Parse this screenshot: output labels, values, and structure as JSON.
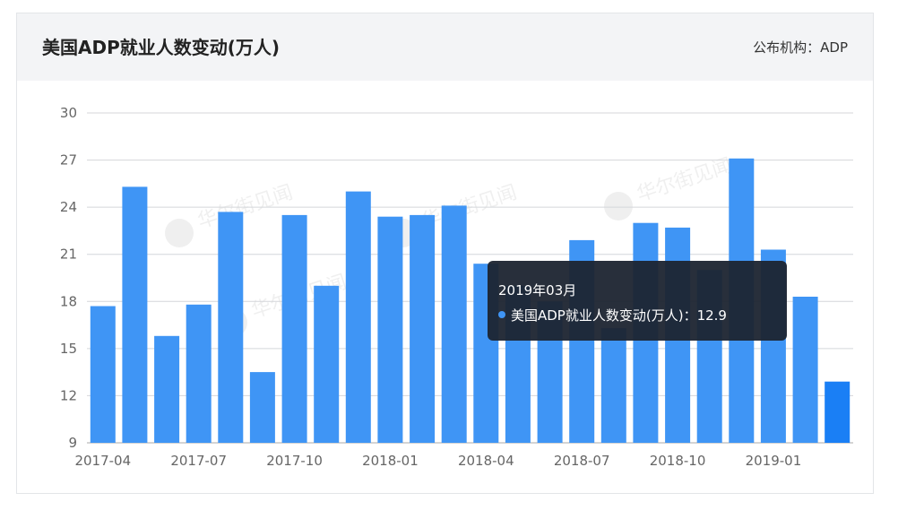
{
  "header": {
    "title": "美国ADP就业人数变动(万人)",
    "source_label": "公布机构：",
    "source_value": "ADP"
  },
  "colors": {
    "bar": "#3f95f5",
    "bar_highlight": "#1a7ff5",
    "grid": "#d4d6da",
    "axis": "#aaaaaa",
    "tooltip_bg": "#1c2430"
  },
  "watermark": {
    "text": "华尔街见闻",
    "icon": "wallstreetcn-logo-icon"
  },
  "chart_data": {
    "type": "bar",
    "title": "美国ADP就业人数变动(万人)",
    "categories": [
      "2017-04",
      "2017-05",
      "2017-06",
      "2017-07",
      "2017-08",
      "2017-09",
      "2017-10",
      "2017-11",
      "2017-12",
      "2018-01",
      "2018-02",
      "2018-03",
      "2018-04",
      "2018-05",
      "2018-06",
      "2018-07",
      "2018-08",
      "2018-09",
      "2018-10",
      "2018-11",
      "2018-12",
      "2019-01",
      "2019-02",
      "2019-03"
    ],
    "series": [
      {
        "name": "美国ADP就业人数变动(万人)",
        "values": [
          17.7,
          25.3,
          15.8,
          17.8,
          23.7,
          13.5,
          23.5,
          19.0,
          25.0,
          23.4,
          23.5,
          24.1,
          20.4,
          19.0,
          18.0,
          21.9,
          16.3,
          23.0,
          22.7,
          20.0,
          27.1,
          21.3,
          18.3,
          12.9
        ]
      }
    ],
    "xlabel": "",
    "ylabel": "",
    "ylim": [
      9,
      30
    ],
    "yticks": [
      9,
      12,
      15,
      18,
      21,
      24,
      27,
      30
    ],
    "xtick_labels": [
      "2017-04",
      "2017-07",
      "2017-10",
      "2018-01",
      "2018-04",
      "2018-07",
      "2018-10",
      "2019-01"
    ],
    "grid": true,
    "legend": "none",
    "highlighted_index": 23
  },
  "tooltip": {
    "title": "2019年03月",
    "series_name": "美国ADP就业人数变动(万人)",
    "separator": "：",
    "value": "12.9"
  }
}
